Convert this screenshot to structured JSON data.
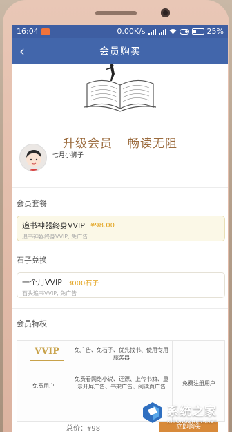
{
  "status_bar": {
    "time": "16:04",
    "speed": "0.00K/s",
    "battery": "25%"
  },
  "header": {
    "title": "会员购买",
    "back_icon": "chevron-left-icon"
  },
  "hero": {
    "slogan_part1": "升级会员",
    "slogan_part2": "畅读无阻"
  },
  "user": {
    "name": "七月小狮子"
  },
  "membership": {
    "section_label": "会员套餐",
    "plan_name": "追书神器终身VVIP",
    "plan_price": "¥98.00",
    "plan_sub": "追书神器终身VVIP, 免广告"
  },
  "stone": {
    "section_label": "石子兑换",
    "plan_name": "一个月VVIP",
    "plan_price": "3000石子",
    "plan_sub": "石头追书VVIP, 免广告"
  },
  "privileges": {
    "section_label": "会员特权",
    "vvip_logo": "VVIP",
    "vvip_desc": "免广告、免石子、优先找书、使用专用服务器",
    "free_user_label": "免费用户",
    "free_user_desc": "免费看网络小说、还源、上传书籍、显示开屏广告、书架广告、阅读页广告",
    "register_label": "免费注册用户"
  },
  "footer": {
    "total": "总价：¥98",
    "buy_label": "立即购买"
  },
  "watermark": {
    "title": "系统之家",
    "url": "XITONGZHIJIA.NET"
  },
  "colors": {
    "status_bar": "#3e5ea2",
    "title_bar": "#4266ab",
    "accent_gold": "#e3a420",
    "slogan": "#9b6b3d"
  }
}
